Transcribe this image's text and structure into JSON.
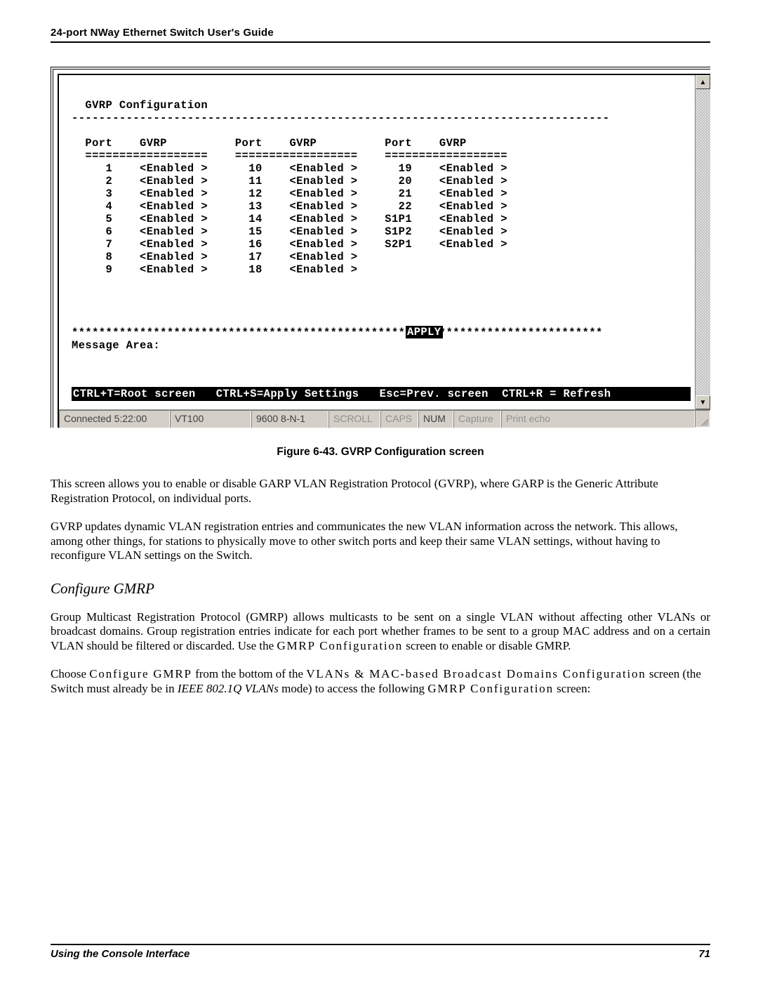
{
  "header": {
    "title": "24-port NWay Ethernet Switch User's Guide"
  },
  "terminal": {
    "title": "GVRP Configuration",
    "dashes": "-------------------------------------------------------------------------------",
    "col_hdr_port": "Port",
    "col_hdr_gvrp": "GVRP",
    "col_sep": "==================",
    "columns": [
      {
        "rows": [
          {
            "port": "1",
            "state": "<Enabled >"
          },
          {
            "port": "2",
            "state": "<Enabled >"
          },
          {
            "port": "3",
            "state": "<Enabled >"
          },
          {
            "port": "4",
            "state": "<Enabled >"
          },
          {
            "port": "5",
            "state": "<Enabled >"
          },
          {
            "port": "6",
            "state": "<Enabled >"
          },
          {
            "port": "7",
            "state": "<Enabled >"
          },
          {
            "port": "8",
            "state": "<Enabled >"
          },
          {
            "port": "9",
            "state": "<Enabled >"
          }
        ]
      },
      {
        "rows": [
          {
            "port": "10",
            "state": "<Enabled >"
          },
          {
            "port": "11",
            "state": "<Enabled >"
          },
          {
            "port": "12",
            "state": "<Enabled >"
          },
          {
            "port": "13",
            "state": "<Enabled >"
          },
          {
            "port": "14",
            "state": "<Enabled >"
          },
          {
            "port": "15",
            "state": "<Enabled >"
          },
          {
            "port": "16",
            "state": "<Enabled >"
          },
          {
            "port": "17",
            "state": "<Enabled >"
          },
          {
            "port": "18",
            "state": "<Enabled >"
          }
        ]
      },
      {
        "rows": [
          {
            "port": "19",
            "state": "<Enabled >"
          },
          {
            "port": "20",
            "state": "<Enabled >"
          },
          {
            "port": "21",
            "state": "<Enabled >"
          },
          {
            "port": "22",
            "state": "<Enabled >"
          },
          {
            "port": "S1P1",
            "state": "<Enabled >"
          },
          {
            "port": "S1P2",
            "state": "<Enabled >"
          },
          {
            "port": "S2P1",
            "state": "<Enabled >"
          }
        ]
      }
    ],
    "apply": "APPLY",
    "stars": "******************************************************************************",
    "msg_label": "Message Area:",
    "hotkeys": "CTRL+T=Root screen   CTRL+S=Apply Settings   Esc=Prev. screen  CTRL+R = Refresh"
  },
  "statusbar": {
    "connected": "Connected 5:22:00",
    "emulation": "VT100",
    "serial": "9600 8-N-1",
    "scroll": "SCROLL",
    "caps": "CAPS",
    "num": "NUM",
    "capture": "Capture",
    "printecho": "Print echo"
  },
  "caption": "Figure 6-43.  GVRP Configuration screen",
  "para1": "This screen allows you to enable or disable GARP VLAN Registration Protocol (GVRP), where GARP is the Generic Attribute Registration Protocol, on individual ports.",
  "para2": "GVRP updates dynamic VLAN registration entries and communicates the new VLAN information across the network. This allows, among other things, for stations to physically move to other switch ports and keep their same VLAN settings, without having to reconfigure VLAN settings on the Switch.",
  "subhead": "Configure GMRP",
  "para3_a": "Group Multicast Registration Protocol (GMRP) allows multicasts to be sent on a single VLAN without affecting other VLANs or broadcast domains. Group registration entries indicate for each port whether frames to be sent to a group MAC address and on a certain VLAN should be filtered or discarded. Use the ",
  "para3_b": "GMRP Configuration",
  "para3_c": " screen to enable or disable GMRP.",
  "para4_a": "Choose ",
  "para4_b": "Configure GMRP",
  "para4_c": " from the bottom of the ",
  "para4_d": "VLANs & MAC-based Broadcast Domains Configuration",
  "para4_e": " screen (the Switch must already be in ",
  "para4_f": "IEEE 802.1Q VLANs",
  "para4_g": " mode) to access the following ",
  "para4_h": "GMRP Configuration",
  "para4_i": " screen:",
  "footer": {
    "left": "Using the Console Interface",
    "right": "71"
  }
}
